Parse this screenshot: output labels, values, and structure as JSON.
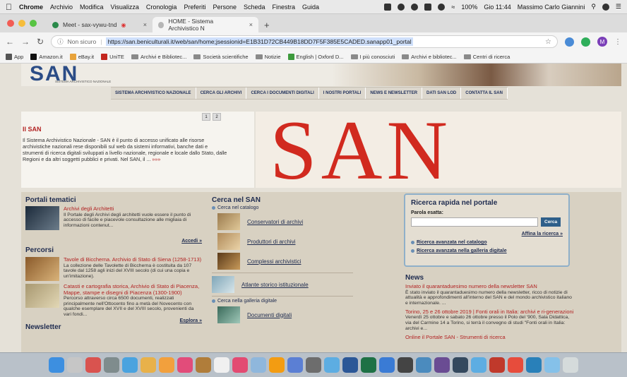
{
  "menubar": {
    "app": "Chrome",
    "items": [
      "Archivio",
      "Modifica",
      "Visualizza",
      "Cronologia",
      "Preferiti",
      "Persone",
      "Scheda",
      "Finestra",
      "Guida"
    ],
    "battery": "100%",
    "clock": "Gio 11:44",
    "user": "Massimo Carlo Giannini"
  },
  "tabs": [
    {
      "title": "Meet - sax-vywu-tnd",
      "color": "#2a8a4a"
    },
    {
      "title": "HOME - Sistema Archivistico N",
      "color": "#b5b5b5"
    }
  ],
  "address": {
    "security": "Non sicuro",
    "url": "https://san.beniculturali.it/web/san/home;jsessionid=E1B31D72CB449B18DD7F5F385E5CADED.sanapp01_portal",
    "avatar_letter": "M"
  },
  "bookmarks": [
    {
      "label": "App",
      "type": "grid"
    },
    {
      "label": "Amazon.it",
      "type": "site"
    },
    {
      "label": "eBay.it",
      "type": "site"
    },
    {
      "label": "UniTE",
      "type": "site"
    },
    {
      "label": "Archivi e Bibliotec...",
      "type": "folder"
    },
    {
      "label": "Società scientifiche",
      "type": "folder"
    },
    {
      "label": "Notizie",
      "type": "folder"
    },
    {
      "label": "English | Oxford D...",
      "type": "site"
    },
    {
      "label": "I più conosciuti",
      "type": "folder"
    },
    {
      "label": "Archivi e bibliotec...",
      "type": "folder"
    },
    {
      "label": "Centri di ricerca",
      "type": "folder"
    }
  ],
  "site": {
    "logo": "SAN",
    "logo_sub": "SISTEMA ARCHIVISTICO NAZIONALE",
    "nav": [
      "SISTEMA ARCHIVISTICO NAZIONALE",
      "CERCA GLI ARCHIVI",
      "CERCA I DOCUMENTI DIGITALI",
      "I NOSTRI PORTALI",
      "NEWS E NEWSLETTER",
      "DATI SAN LOD",
      "CONTATTA IL SAN"
    ],
    "pager": [
      "1",
      "2"
    ],
    "hero_title": "Il SAN",
    "hero_text": "Il Sistema Archivistico Nazionale - SAN è il punto di accesso unificato alle risorse archivistiche nazionali rese disponibili sul web da sistemi informativi, banche dati e strumenti di ricerca digitali sviluppati a livello nazionale, regionale e locale dallo Stato, dalle Regioni e da altri soggetti pubblici e privati. Nel SAN, il ...",
    "hero_more": "»»»",
    "hero_banner": "SAN",
    "portali": {
      "title": "Portali tematici",
      "item_title": "Archivi degli Architetti",
      "item_text": "Il Portale degli Archivi degli architetti vuole essere il punto di accesso di facile e piacevole consultazione alle migliaia di informazioni contenut...",
      "link": "Accedi »"
    },
    "percorsi": {
      "title": "Percorsi",
      "items": [
        {
          "title": "Tavole di Biccherna. Archivio di Stato di Siena (1258-1713)",
          "text": "La collezione delle Tavolette di Biccherna è costituita da 107 tavole dal 1258 agli inizi del XVIII secolo (di cui una copia e un'imitazione)."
        },
        {
          "title": "Catasti e cartografia storica, Archivio di Stato di Piacenza, Mappe, stampe e disegni di Piacenza (1300-1900)",
          "text": "Percorso attraverso circa 6500 documenti, realizzati principalmente nell'Ottocento fino a metà del Novecento con qualche esemplare del XVII e del XVIII secolo, provenienti da vari fondi..."
        }
      ],
      "link": "Esplora »"
    },
    "newsletter_title": "Newsletter",
    "cerca": {
      "title": "Cerca nel SAN",
      "sub1": "Cerca nel catalogo",
      "items": [
        "Conservatori di archivi",
        "Produttori di archivi",
        "Complessi archivistici",
        "Atlante storico istituzionale"
      ],
      "sub2": "Cerca nella galleria digitale",
      "items2": [
        "Documenti digitali"
      ]
    },
    "ricerca": {
      "title": "Ricerca rapida nel portale",
      "label": "Parola esatta:",
      "button": "Cerca",
      "refine": "Affina la ricerca »",
      "links": [
        "Ricerca avanzata nel catalogo",
        "Ricerca avanzata nella galleria digitale"
      ]
    },
    "news": {
      "title": "News",
      "items": [
        {
          "title": "Inviato il quarantaduesimo numero della newsletter SAN",
          "text": "È stato inviato il quarantaduesimo numero della newsletter, ricco di notizie di attualità e approfondimenti all'interno del SAN e del mondo archivistico italiano e internazionale. ..."
        },
        {
          "title": "Torino, 25 e 26 ottobre 2019 | Fonti orali in Italia: archivi e ri-generazioni",
          "text": "Venerdì 25 ottobre e sabato 26 ottobre presso il Polo del '900, Sala Didattica, via del Carmine 14 a Torino, si terrà il convegno di studi \"Fonti orali in Italia: archivi e..."
        },
        {
          "title": "Online il Portale SAN - Strumenti di ricerca",
          "text": ""
        }
      ]
    }
  },
  "colors": {
    "accent_red": "#b22222",
    "navy": "#1e2b4f",
    "san_red": "#d12a1f"
  }
}
